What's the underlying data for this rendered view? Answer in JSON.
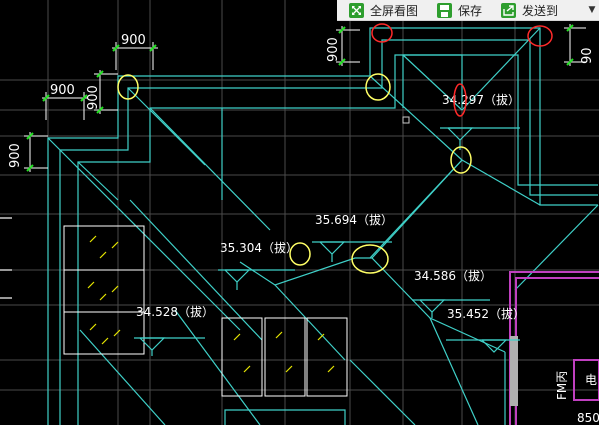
{
  "toolbar": {
    "fullscreen_label": "全屏看图",
    "save_label": "保存",
    "send_label": "发送到",
    "more_symbol": "▼"
  },
  "drawing": {
    "dimensions": [
      "900",
      "900",
      "900",
      "900",
      "900"
    ],
    "elevations": {
      "e1": "34.297（拔）",
      "e2": "35.694（拔）",
      "e3": "35.304（拔）",
      "e4": "34.586（拔）",
      "e5": "34.528（拔）",
      "e6": "35.452（拔）"
    },
    "room_labels": {
      "fm": "FM丙",
      "elec": "电",
      "num": "850"
    }
  },
  "colors": {
    "background": "#000000",
    "roof_lines": "#3fd0c8",
    "dimension": "#ffffff",
    "dimension_tick": "#22dd22",
    "highlight": "#ffff66",
    "highlight_red": "#ff2a2a",
    "glazing": "#e6e600",
    "wall": "#c040c0",
    "grid": "#555555"
  }
}
